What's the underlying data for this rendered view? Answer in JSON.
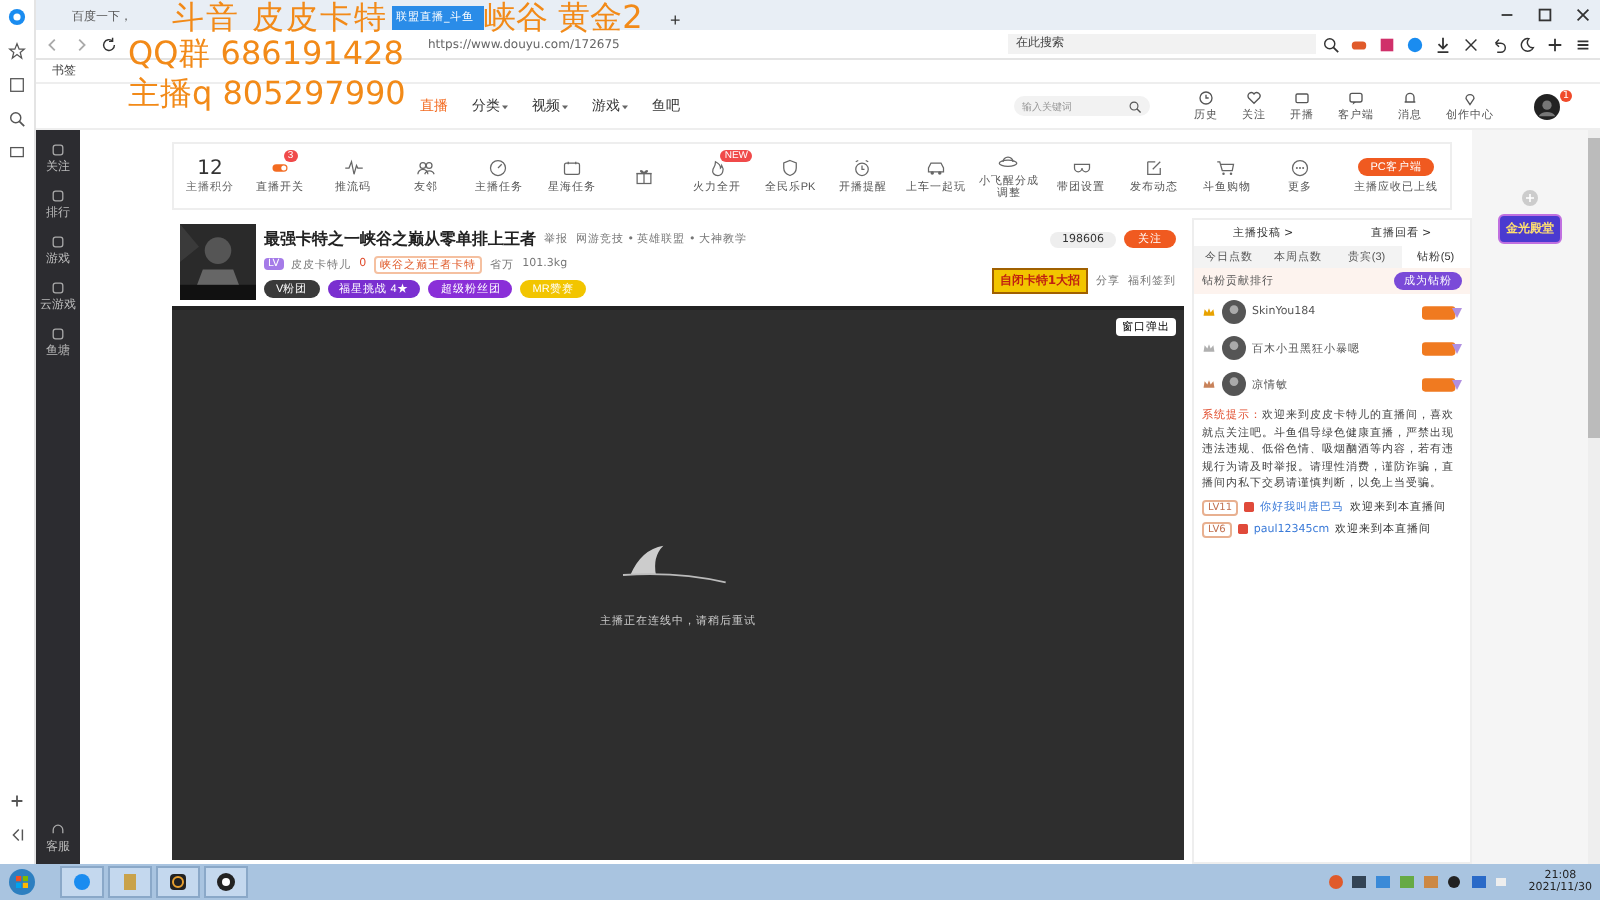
{
  "browser": {
    "tabs": [
      {
        "title": "百度一下，",
        "selected": false
      },
      {
        "title": "联盟直播_斗鱼",
        "selected": true
      }
    ],
    "new_tab": "+",
    "url": "https://www.douyu.com/172675",
    "search_placeholder": "在此搜索",
    "bookmarks": [
      "书签"
    ]
  },
  "overlay": [
    "斗音 皮皮卡特",
    "峡谷 黄金2",
    "QQ群 686191428",
    "主播q 805297990"
  ],
  "site": {
    "nav": [
      {
        "label": "直播",
        "selected": true,
        "dropdown": false
      },
      {
        "label": "分类",
        "selected": false,
        "dropdown": true
      },
      {
        "label": "视频",
        "selected": false,
        "dropdown": true
      },
      {
        "label": "游戏",
        "selected": false,
        "dropdown": true
      },
      {
        "label": "鱼吧",
        "selected": false,
        "dropdown": false
      }
    ],
    "search_placeholder": "输入关键词",
    "header_items": [
      "历史",
      "关注",
      "开播",
      "客户端",
      "消息",
      "创作中心"
    ],
    "avatar_badge": "1"
  },
  "sidebar": {
    "items": [
      "关注",
      "排行",
      "游戏",
      "云游戏",
      "鱼塘"
    ],
    "bottom": "客服"
  },
  "toolbar": {
    "score": "12",
    "score_label": "主播积分",
    "items": [
      {
        "label": "直播开关",
        "badge": "3"
      },
      {
        "label": "推流码"
      },
      {
        "label": "友邻"
      },
      {
        "label": "主播任务"
      },
      {
        "label": "星海任务"
      }
    ],
    "items_after_gift": [
      {
        "label": "火力全开",
        "badge": "NEW"
      },
      {
        "label": "全民乐PK"
      },
      {
        "label": "开播提醒"
      },
      {
        "label": "上车一起玩"
      },
      {
        "label": "小飞醒分成调整"
      },
      {
        "label": "带团设置"
      },
      {
        "label": "发布动态"
      },
      {
        "label": "斗鱼购物"
      },
      {
        "label": "更多"
      }
    ],
    "pc_button": "PC客户端",
    "pc_note": "主播应收已上线"
  },
  "streamer": {
    "title": "最强卡特之一峡谷之巅从零单排上王者",
    "report": "举报",
    "category": "网游竞技 • 英雄联盟 • 大神教学",
    "level": "LV",
    "name": "皮皮卡特儿",
    "hot": "0",
    "honor": "峡谷之巅王者卡特",
    "rank": "省万",
    "weight": "101.3kg",
    "badges": [
      {
        "label": "V粉团",
        "color": "#3a3a3a"
      },
      {
        "label": "福星挑战 4★",
        "color": "#7a2fd0"
      },
      {
        "label": "超级粉丝团",
        "color": "#8a2fd8"
      },
      {
        "label": "MR赞赛",
        "color": "#f2c500"
      }
    ],
    "followers": "198606",
    "follow": "关注",
    "banner": "自闭卡特1大招",
    "share": "分享",
    "signin": "福利签到"
  },
  "video": {
    "popout": "窗口弹出",
    "message": "主播正在连线中，请稍后重试"
  },
  "panel": {
    "links": [
      "主播投稿 >",
      "直播回看 >"
    ],
    "tabs": [
      {
        "label": "今日点数",
        "selected": false
      },
      {
        "label": "本周点数",
        "selected": false
      },
      {
        "label": "贵宾(3)",
        "selected": false
      },
      {
        "label": "钻粉(5)",
        "selected": true
      }
    ],
    "rank_title": "钻粉贡献排行",
    "become": "成为钻粉",
    "ranks": [
      {
        "name": "SkinYou184",
        "color": "#e8a200"
      },
      {
        "name": "百木小丑黑狂小暴嗯",
        "color": "#b0b0b0"
      },
      {
        "name": "凉情敏",
        "color": "#c8825a"
      }
    ],
    "system_label": "系统提示：",
    "system_text": "欢迎来到皮皮卡特儿的直播间，喜欢就点关注吧。斗鱼倡导绿色健康直播，严禁出现违法违规、低俗色情、吸烟酗酒等内容，若有违规行为请及时举报。请理性消费，谨防诈骗，直播间内私下交易请谨慎判断，以免上当受骗。",
    "messages": [
      {
        "level": "LV11",
        "user": "你好我叫唐巴马",
        "text": "欢迎来到本直播间"
      },
      {
        "level": "LV6",
        "user": "paul12345cm",
        "text": "欢迎来到本直播间"
      }
    ]
  },
  "promo": "金光殿堂",
  "taskbar": {
    "time": "21:08",
    "date": "2021/11/30"
  }
}
